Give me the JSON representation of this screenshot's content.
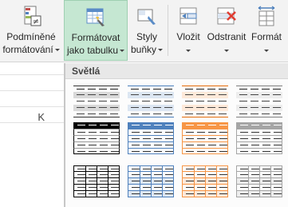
{
  "ribbon": {
    "buttons": [
      {
        "id": "conditional",
        "line1": "Podmíněné",
        "line2": "formátování",
        "icon": "conditional-formatting-icon"
      },
      {
        "id": "format_table",
        "line1": "Formátovat",
        "line2": "jako tabulku",
        "icon": "format-as-table-icon",
        "active": true
      },
      {
        "id": "cell_styles",
        "line1": "Styly",
        "line2": "buňky",
        "icon": "cell-styles-icon"
      },
      {
        "id": "insert",
        "line1": "Vložit",
        "icon": "insert-cells-icon"
      },
      {
        "id": "delete",
        "line1": "Odstranit",
        "icon": "delete-cells-icon"
      },
      {
        "id": "format",
        "line1": "Formát",
        "icon": "format-cells-icon"
      }
    ]
  },
  "sheet": {
    "column_label": "K"
  },
  "gallery": {
    "section_label": "Světlá",
    "styles": [
      {
        "name": "light-1",
        "accent": "#333333",
        "band": "#d9d9d9",
        "type": "banded"
      },
      {
        "name": "light-2",
        "accent": "#4a7ebb",
        "band": "#dce6f2",
        "type": "banded"
      },
      {
        "name": "light-3",
        "accent": "#e46c0a",
        "band": "#fde9d9",
        "type": "banded"
      },
      {
        "name": "light-4",
        "accent": "#7f7f7f",
        "band": "#ededed",
        "type": "banded"
      },
      {
        "name": "light-8",
        "accent": "#000000",
        "band": "#ffffff",
        "type": "header"
      },
      {
        "name": "light-9",
        "accent": "#4f81bd",
        "band": "#ffffff",
        "type": "header"
      },
      {
        "name": "light-10",
        "accent": "#f79646",
        "band": "#ffffff",
        "type": "header"
      },
      {
        "name": "light-11",
        "accent": "#a5a5a5",
        "band": "#ffffff",
        "type": "header"
      },
      {
        "name": "light-15",
        "accent": "#000000",
        "band": "#ffffff",
        "type": "grid"
      },
      {
        "name": "light-16",
        "accent": "#4f81bd",
        "band": "#dce6f2",
        "type": "grid"
      },
      {
        "name": "light-17",
        "accent": "#f79646",
        "band": "#fde9d9",
        "type": "grid"
      },
      {
        "name": "light-18",
        "accent": "#a5a5a5",
        "band": "#ededed",
        "type": "grid"
      }
    ]
  }
}
